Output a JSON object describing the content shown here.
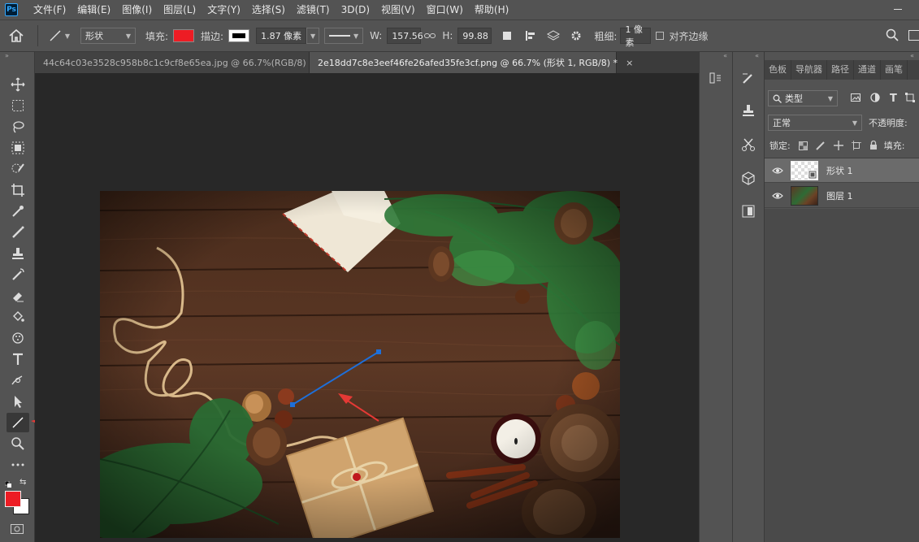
{
  "app": {
    "logo": "Ps"
  },
  "menu": [
    "文件(F)",
    "编辑(E)",
    "图像(I)",
    "图层(L)",
    "文字(Y)",
    "选择(S)",
    "滤镜(T)",
    "3D(D)",
    "视图(V)",
    "窗口(W)",
    "帮助(H)"
  ],
  "options": {
    "mode": "形状",
    "fill_label": "填充:",
    "fill_color": "#ed1c24",
    "stroke_label": "描边:",
    "stroke_width": "1.87 像素",
    "w_label": "W:",
    "w_value": "157.56",
    "h_label": "H:",
    "h_value": "99.88 像",
    "weight_label": "粗细:",
    "weight_value": "1 像素",
    "align_edges_label": "对齐边缘"
  },
  "tabs": [
    {
      "label": "44c64c03e3528c958b8c1c9cf8e65ea.jpg @ 66.7%(RGB/8)",
      "close": "×"
    },
    {
      "label": "2e18dd7c8e3eef46fe26afed35fe3cf.png @ 66.7% (形状 1, RGB/8) *",
      "close": "×"
    }
  ],
  "colors": {
    "foreground": "#ed1c24",
    "background": "#ffffff",
    "line_color": "#1e6fd9",
    "arrow_color": "#e53935"
  },
  "panel": {
    "tabs": [
      "色板",
      "导航器",
      "路径",
      "通道",
      "画笔"
    ],
    "filter_kind": "类型",
    "blend_mode": "正常",
    "opacity_label": "不透明度:",
    "lock_label": "锁定:",
    "fill_label": "填充:",
    "layers": [
      {
        "name": "形状 1",
        "selected": true
      },
      {
        "name": "图层 1",
        "selected": false
      }
    ]
  }
}
